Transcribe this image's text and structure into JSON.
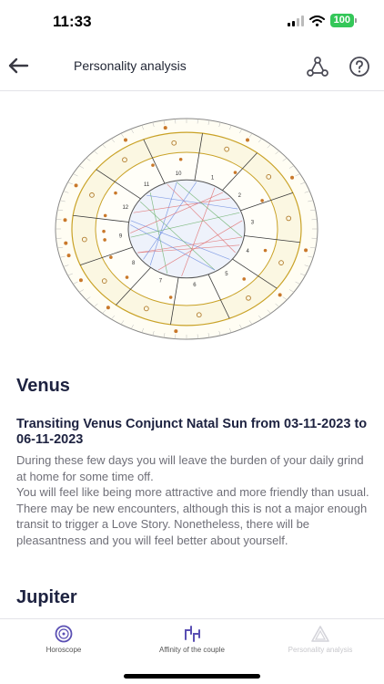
{
  "status": {
    "time": "11:33",
    "battery": "100",
    "icons": [
      "signal-icon",
      "wifi-icon",
      "battery-icon"
    ]
  },
  "header": {
    "title": "Personality analysis",
    "icons": [
      "back-arrow-icon",
      "share-icon",
      "help-icon"
    ]
  },
  "chart": {
    "icon": "natal-chart-wheel",
    "house_numbers": [
      "12",
      "11",
      "10",
      "1",
      "2",
      "3",
      "4",
      "5",
      "6",
      "7",
      "8",
      "9"
    ]
  },
  "content": {
    "section_title": "Venus",
    "transit_title": "Transiting Venus Conjunct Natal Sun from 03-11-2023 to 06-11-2023",
    "paragraphs": [
      "During these few days you will leave the burden of your daily grind at home for some time off.",
      "You will feel like being more attractive and more friendly than usual.",
      "There may be new encounters, although this is not a major enough transit to trigger a Love Story. Nonetheless, there will be pleasantness and you will feel better about yourself."
    ],
    "next_section_title": "Jupiter"
  },
  "tabs": [
    {
      "label": "Horoscope",
      "icon": "horoscope-icon",
      "active": true
    },
    {
      "label": "Affinity of the couple",
      "icon": "affinity-icon",
      "active": true
    },
    {
      "label": "Personality analysis",
      "icon": "personality-icon",
      "active": false
    }
  ],
  "colors": {
    "accent": "#5a4fb3",
    "title": "#1d2240",
    "body_text": "#6f6f78",
    "chart_gold": "#c9a227",
    "battery": "#34c759"
  }
}
